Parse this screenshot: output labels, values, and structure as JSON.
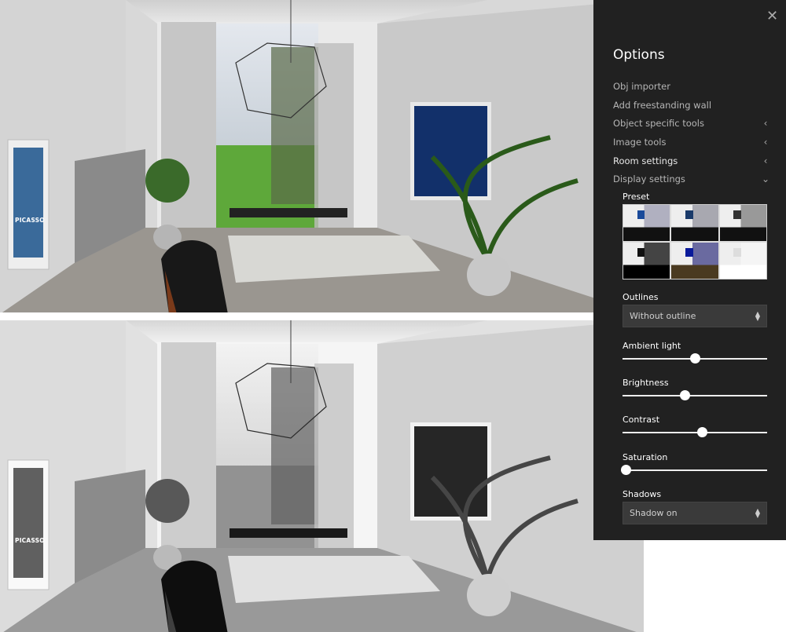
{
  "panel": {
    "title": "Options",
    "close_icon": "close-x-icon",
    "menu": [
      {
        "label": "Obj importer",
        "chevron": ""
      },
      {
        "label": "Add freestanding wall",
        "chevron": ""
      },
      {
        "label": "Object specific tools",
        "chevron": "‹"
      },
      {
        "label": "Image tools",
        "chevron": "‹"
      },
      {
        "label": "Room settings",
        "chevron": "‹"
      },
      {
        "label": "Display settings",
        "chevron": "⌄"
      }
    ],
    "preset_label": "Preset",
    "presets": [
      {
        "wall": "#b0b0c0",
        "art": "#1a4a9a",
        "floor": "#111"
      },
      {
        "wall": "#a8a8b0",
        "art": "#1a3a6a",
        "floor": "#111"
      },
      {
        "wall": "#999",
        "art": "#333",
        "floor": "#111"
      },
      {
        "wall": "#444",
        "art": "#111",
        "floor": "#000"
      },
      {
        "wall": "#6a6aa0",
        "art": "#0a1a9a",
        "floor": "#4a3a20"
      },
      {
        "wall": "#f5f5f5",
        "art": "#ddd",
        "floor": "#fff"
      }
    ],
    "outlines_label": "Outlines",
    "outlines_value": "Without outline",
    "sliders": [
      {
        "label": "Ambient light",
        "value": 0.5
      },
      {
        "label": "Brightness",
        "value": 0.43
      },
      {
        "label": "Contrast",
        "value": 0.55
      },
      {
        "label": "Saturation",
        "value": 0.02
      }
    ],
    "shadows_label": "Shadows",
    "shadows_value": "Shadow on"
  },
  "renders": {
    "top": {
      "mode": "color"
    },
    "bottom": {
      "mode": "grayscale"
    },
    "poster_text": "PICASSO"
  }
}
